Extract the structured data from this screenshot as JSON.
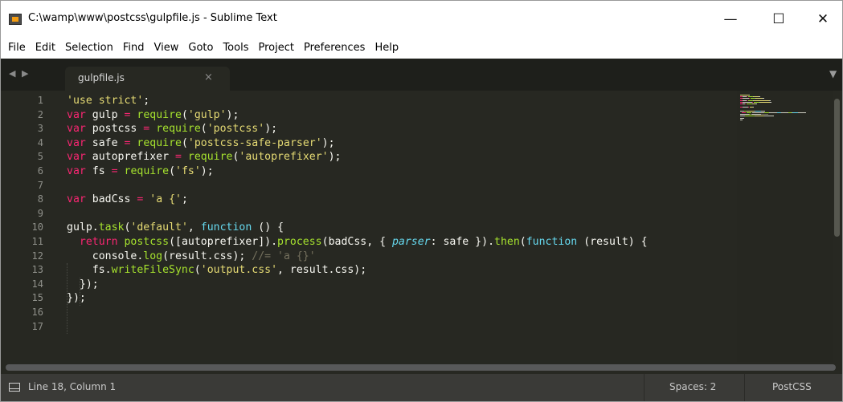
{
  "window": {
    "title": "C:\\wamp\\www\\postcss\\gulpfile.js - Sublime Text",
    "minimize_glyph": "—",
    "maximize_glyph": "☐",
    "close_glyph": "✕"
  },
  "menu": [
    "File",
    "Edit",
    "Selection",
    "Find",
    "View",
    "Goto",
    "Tools",
    "Project",
    "Preferences",
    "Help"
  ],
  "tabs": {
    "nav_arrows": "◀ ▶",
    "active": {
      "label": "gulpfile.js",
      "close": "×"
    },
    "dropdown_glyph": "▼"
  },
  "editor": {
    "line_numbers": [
      "1",
      "2",
      "3",
      "4",
      "5",
      "6",
      "7",
      "8",
      "9",
      "10",
      "11",
      "12",
      "13",
      "14",
      "15",
      "16",
      "17"
    ],
    "lines": [
      [
        {
          "t": "'use strict'",
          "c": "s"
        },
        {
          "t": ";",
          "c": ""
        }
      ],
      [
        {
          "t": "var",
          "c": "k"
        },
        {
          "t": " gulp ",
          "c": ""
        },
        {
          "t": "=",
          "c": "k"
        },
        {
          "t": " ",
          "c": ""
        },
        {
          "t": "require",
          "c": "f"
        },
        {
          "t": "(",
          "c": ""
        },
        {
          "t": "'gulp'",
          "c": "s"
        },
        {
          "t": ");",
          "c": ""
        }
      ],
      [
        {
          "t": "var",
          "c": "k"
        },
        {
          "t": " postcss ",
          "c": ""
        },
        {
          "t": "=",
          "c": "k"
        },
        {
          "t": " ",
          "c": ""
        },
        {
          "t": "require",
          "c": "f"
        },
        {
          "t": "(",
          "c": ""
        },
        {
          "t": "'postcss'",
          "c": "s"
        },
        {
          "t": ");",
          "c": ""
        }
      ],
      [
        {
          "t": "var",
          "c": "k"
        },
        {
          "t": " safe ",
          "c": ""
        },
        {
          "t": "=",
          "c": "k"
        },
        {
          "t": " ",
          "c": ""
        },
        {
          "t": "require",
          "c": "f"
        },
        {
          "t": "(",
          "c": ""
        },
        {
          "t": "'postcss-safe-parser'",
          "c": "s"
        },
        {
          "t": ");",
          "c": ""
        }
      ],
      [
        {
          "t": "var",
          "c": "k"
        },
        {
          "t": " autoprefixer ",
          "c": ""
        },
        {
          "t": "=",
          "c": "k"
        },
        {
          "t": " ",
          "c": ""
        },
        {
          "t": "require",
          "c": "f"
        },
        {
          "t": "(",
          "c": ""
        },
        {
          "t": "'autoprefixer'",
          "c": "s"
        },
        {
          "t": ");",
          "c": ""
        }
      ],
      [
        {
          "t": "var",
          "c": "k"
        },
        {
          "t": " fs ",
          "c": ""
        },
        {
          "t": "=",
          "c": "k"
        },
        {
          "t": " ",
          "c": ""
        },
        {
          "t": "require",
          "c": "f"
        },
        {
          "t": "(",
          "c": ""
        },
        {
          "t": "'fs'",
          "c": "s"
        },
        {
          "t": ");",
          "c": ""
        }
      ],
      [],
      [
        {
          "t": "var",
          "c": "k"
        },
        {
          "t": " badCss ",
          "c": ""
        },
        {
          "t": "=",
          "c": "k"
        },
        {
          "t": " ",
          "c": ""
        },
        {
          "t": "'a {'",
          "c": "s"
        },
        {
          "t": ";",
          "c": ""
        }
      ],
      [],
      [
        {
          "t": "gulp.",
          "c": ""
        },
        {
          "t": "task",
          "c": "f"
        },
        {
          "t": "(",
          "c": ""
        },
        {
          "t": "'default'",
          "c": "s"
        },
        {
          "t": ", ",
          "c": ""
        },
        {
          "t": "function",
          "c": "t"
        },
        {
          "t": " () {",
          "c": ""
        }
      ],
      [
        {
          "t": "  ",
          "c": ""
        },
        {
          "t": "return",
          "c": "k"
        },
        {
          "t": " ",
          "c": ""
        },
        {
          "t": "postcss",
          "c": "f"
        },
        {
          "t": "([autoprefixer]).",
          "c": ""
        },
        {
          "t": "process",
          "c": "f"
        },
        {
          "t": "(badCss, { ",
          "c": ""
        },
        {
          "t": "parser",
          "c": "p"
        },
        {
          "t": ": safe }).",
          "c": ""
        },
        {
          "t": "then",
          "c": "f"
        },
        {
          "t": "(",
          "c": ""
        },
        {
          "t": "function",
          "c": "t"
        },
        {
          "t": " (result) {",
          "c": ""
        }
      ],
      [
        {
          "t": "    console.",
          "c": ""
        },
        {
          "t": "log",
          "c": "f"
        },
        {
          "t": "(result.css); ",
          "c": ""
        },
        {
          "t": "//= 'a {}'",
          "c": "c"
        }
      ],
      [
        {
          "t": "    fs.",
          "c": ""
        },
        {
          "t": "writeFileSync",
          "c": "f"
        },
        {
          "t": "(",
          "c": ""
        },
        {
          "t": "'output.css'",
          "c": "s"
        },
        {
          "t": ", result.css);",
          "c": ""
        }
      ],
      [
        {
          "t": "  });",
          "c": ""
        }
      ],
      [
        {
          "t": "});",
          "c": ""
        }
      ],
      [],
      []
    ]
  },
  "status": {
    "position": "Line 18, Column 1",
    "indentation": "Spaces: 2",
    "syntax": "PostCSS"
  },
  "colors": {
    "editor_bg": "#272822",
    "keyword": "#f92672",
    "string": "#e6db74",
    "function": "#a6e22e",
    "storage": "#66d9ef",
    "comment": "#75715e"
  }
}
